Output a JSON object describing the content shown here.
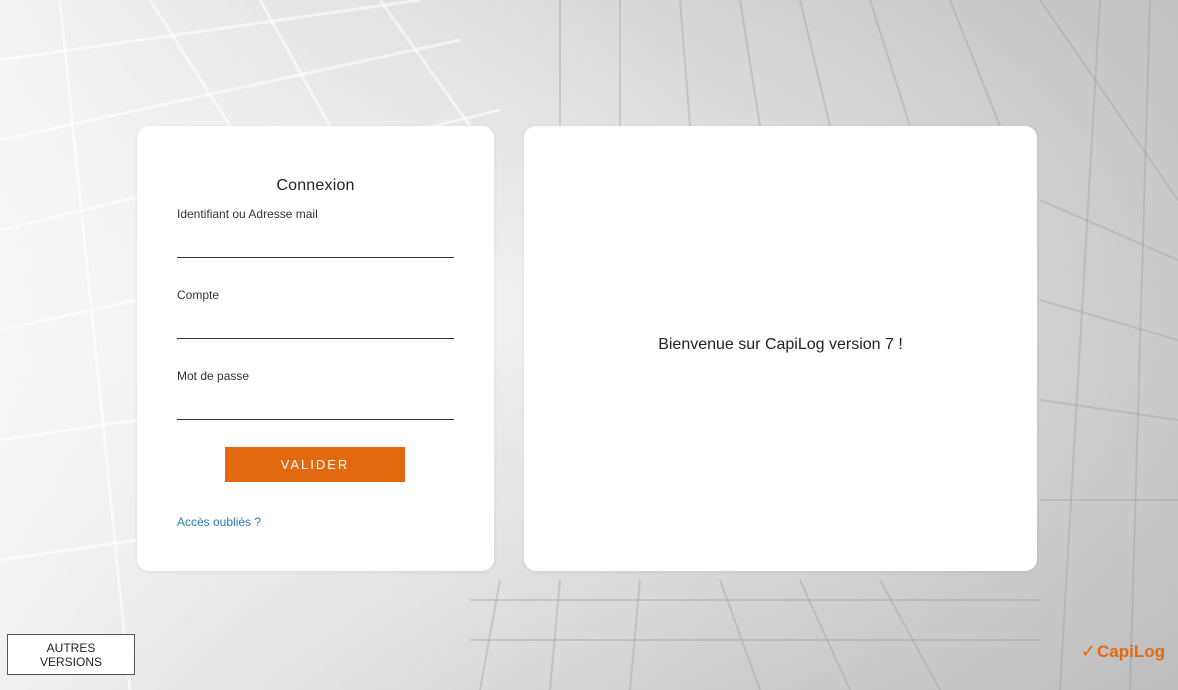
{
  "login": {
    "title": "Connexion",
    "username_label": "Identifiant ou Adresse mail",
    "username_value": "",
    "account_label": "Compte",
    "account_value": "",
    "password_label": "Mot de passe",
    "password_value": "",
    "submit_label": "VALIDER",
    "forgot_label": "Accès oubliés ?"
  },
  "welcome": {
    "message": "Bienvenue sur CapiLog version 7 !"
  },
  "footer": {
    "versions_label": "AUTRES VERSIONS",
    "logo_text": "CapiLog",
    "logo_icon": "checkmark-icon"
  },
  "colors": {
    "accent": "#e2690f",
    "link": "#2a7ab8",
    "card": "#ffffff"
  }
}
